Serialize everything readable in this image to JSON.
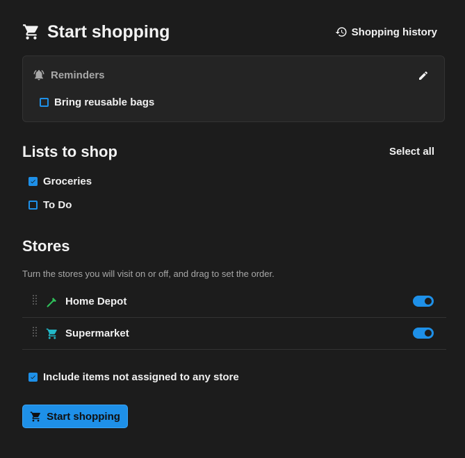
{
  "header": {
    "title": "Start shopping",
    "history_label": "Shopping history"
  },
  "reminders": {
    "title": "Reminders",
    "items": [
      {
        "label": "Bring reusable bags",
        "checked": false
      }
    ]
  },
  "lists": {
    "title": "Lists to shop",
    "select_all_label": "Select all",
    "items": [
      {
        "label": "Groceries",
        "checked": true
      },
      {
        "label": "To Do",
        "checked": false
      }
    ]
  },
  "stores": {
    "title": "Stores",
    "description": "Turn the stores you will visit on or off, and drag to set the order.",
    "items": [
      {
        "name": "Home Depot",
        "icon": "hammer-icon",
        "icon_color": "#2fbf5a",
        "enabled": true
      },
      {
        "name": "Supermarket",
        "icon": "cart-icon",
        "icon_color": "#22b8c8",
        "enabled": true
      }
    ]
  },
  "include_unassigned": {
    "label": "Include items not assigned to any store",
    "checked": true
  },
  "start_button": {
    "label": "Start shopping"
  },
  "colors": {
    "accent": "#1e90e8",
    "background": "#1c1c1c",
    "card": "#242424"
  }
}
